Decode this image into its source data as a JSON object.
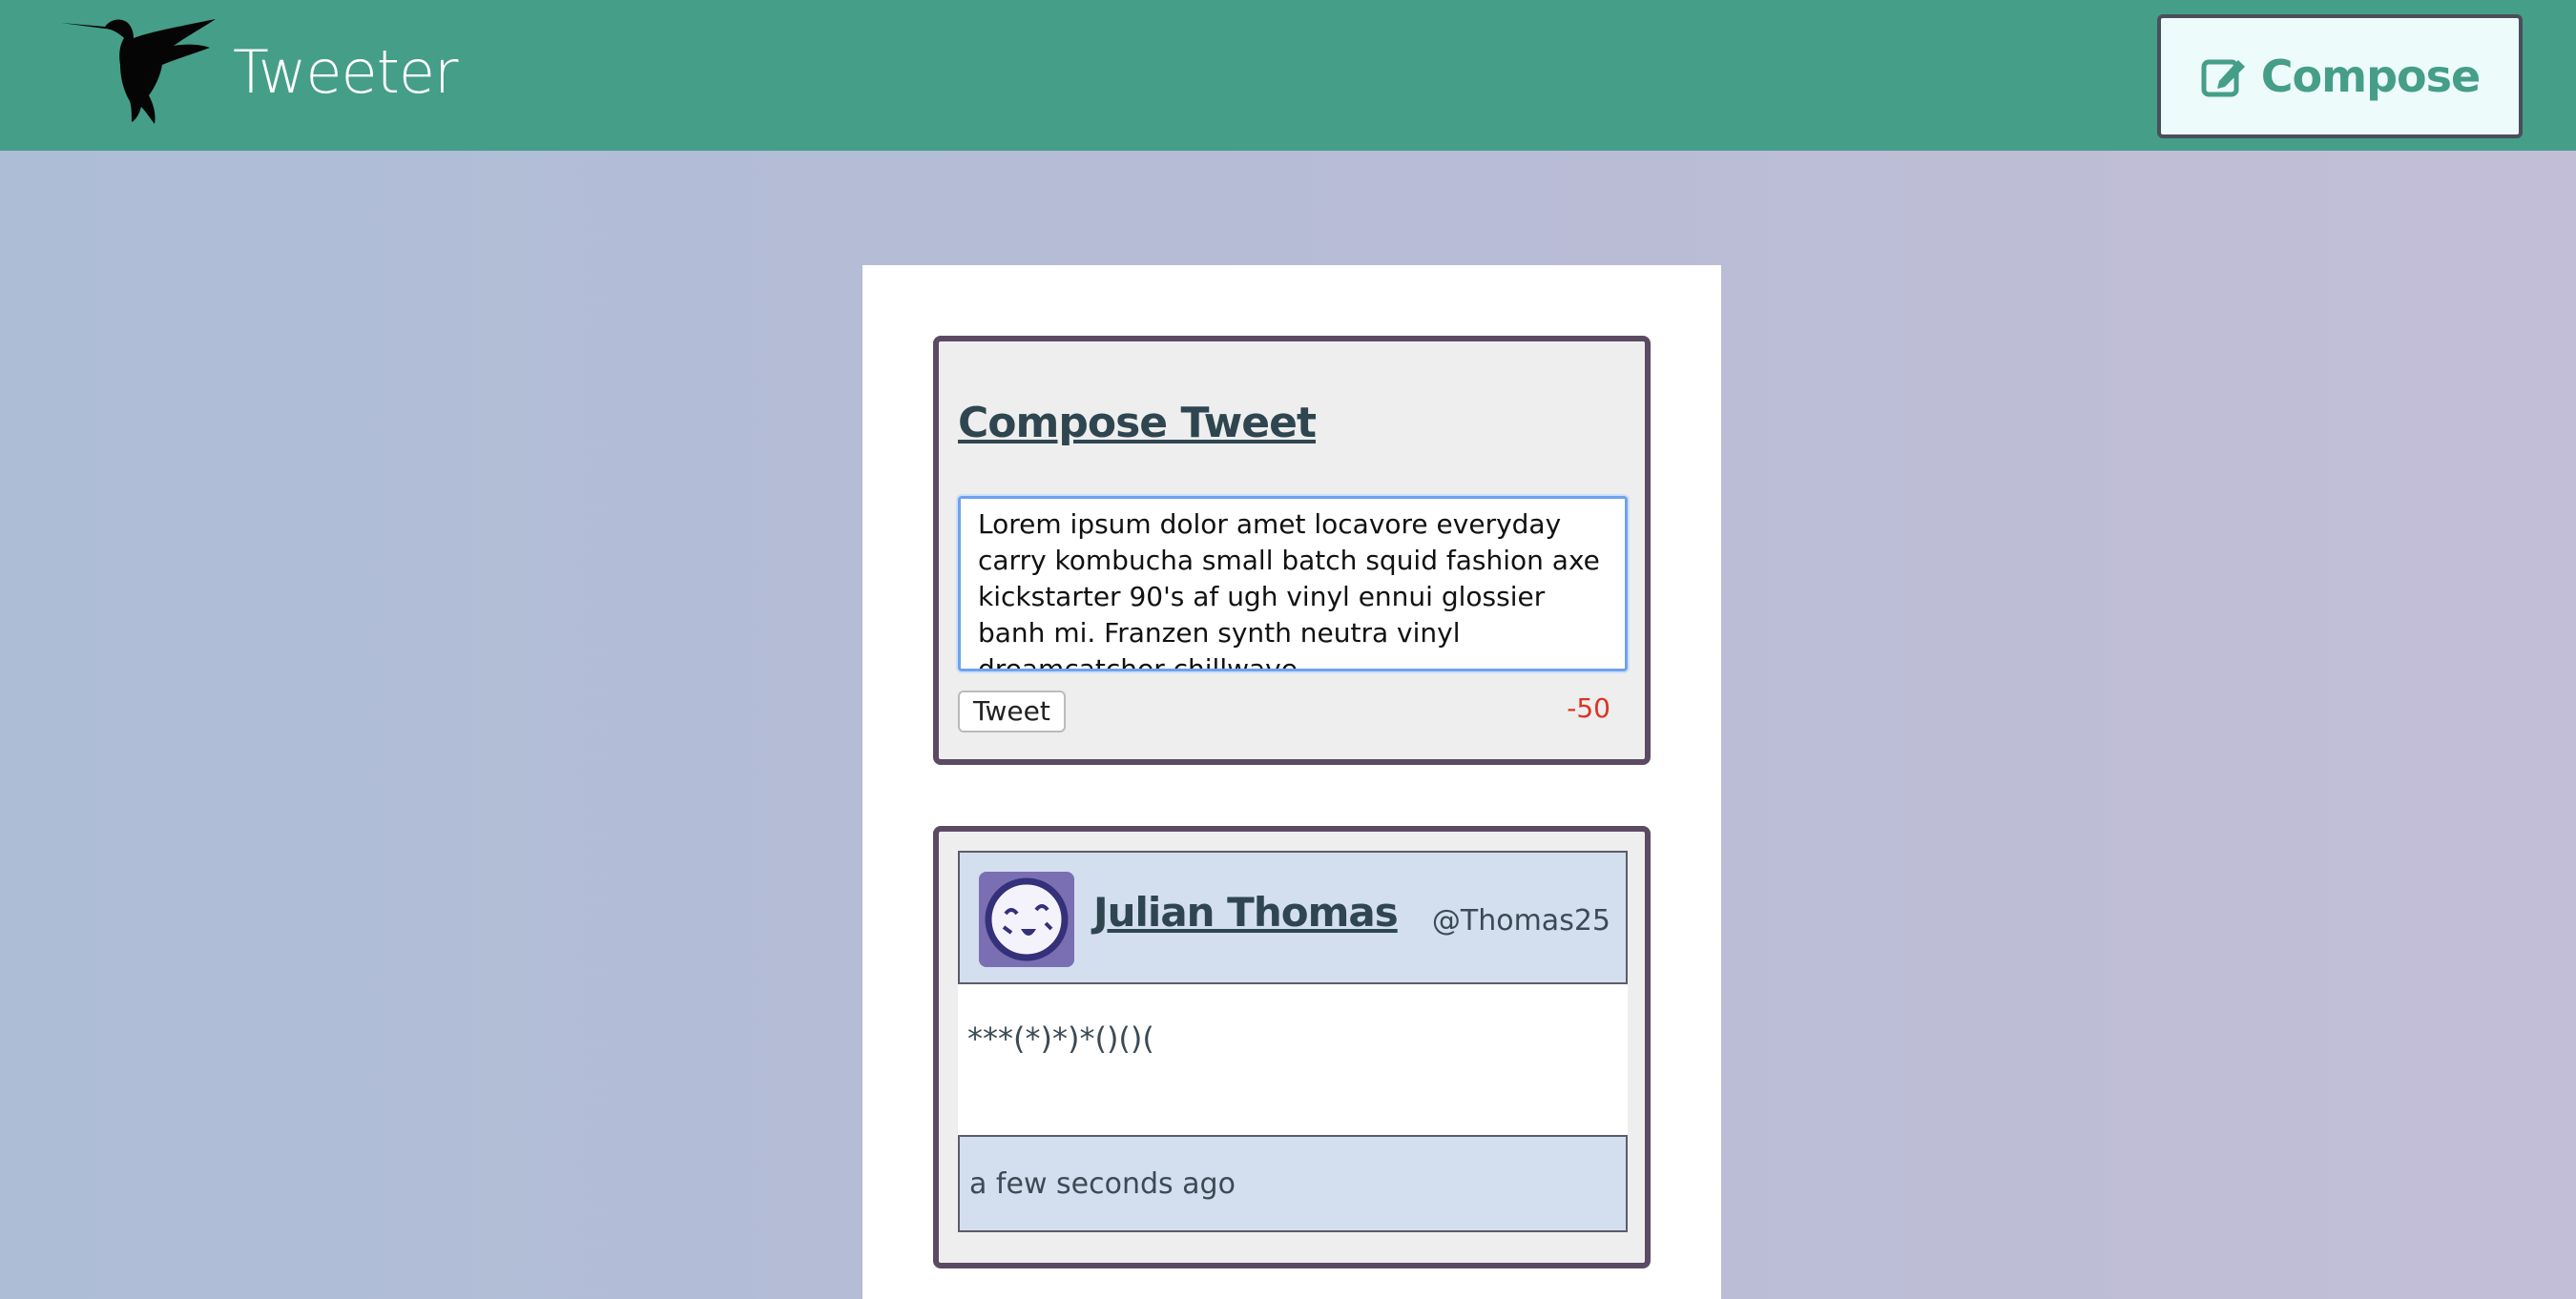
{
  "header": {
    "brand": "Tweeter",
    "compose_label": "Compose",
    "icons": {
      "logo": "hummingbird-icon",
      "compose": "edit-icon"
    }
  },
  "compose": {
    "title": "Compose Tweet",
    "text": "Lorem ipsum dolor amet locavore everyday carry kombucha small batch squid fashion axe kickstarter 90's af ugh vinyl ennui glossier banh mi. Franzen synth neutra vinyl dreamcatcher chillwave.",
    "tweet_button": "Tweet",
    "counter": "-50"
  },
  "tweet": {
    "name": "Julian Thomas",
    "handle": "@Thomas25",
    "content": "***(*)*)*()()(",
    "time": "a few seconds ago"
  },
  "colors": {
    "header_bg": "#459e88",
    "accent": "#459e88",
    "card_border": "#5b4a63",
    "counter_negative": "#dd3322"
  }
}
